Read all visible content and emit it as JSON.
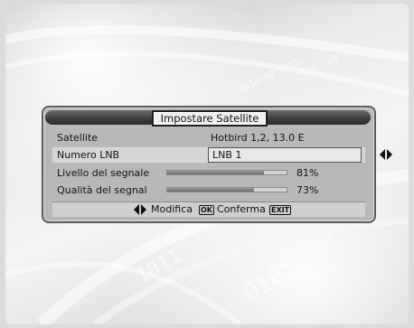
{
  "dialog": {
    "title": "Impostare Satellite",
    "rows": [
      {
        "label": "Satellite",
        "value": "Hotbird 1,2, 13.0 E"
      },
      {
        "label": "Numero LNB",
        "value": "LNB 1"
      },
      {
        "label": "Livello del segnale",
        "percent": "81%",
        "level": 0.81
      },
      {
        "label": "Qualità del segnal",
        "percent": "73%",
        "level": 0.73
      }
    ],
    "footer": {
      "modify_label": "Modifica",
      "ok_key": "OK",
      "confirm_label": "Conferma",
      "exit_key": "EXIT"
    }
  },
  "colors": {
    "panel": "#b8b8b8",
    "title_bar": "#3c3c3c",
    "bar_fill": "#6a6a6a"
  },
  "icons": {
    "lnb_arrows": "left-right-arrows-icon",
    "footer_arrows": "left-right-arrows-icon"
  }
}
